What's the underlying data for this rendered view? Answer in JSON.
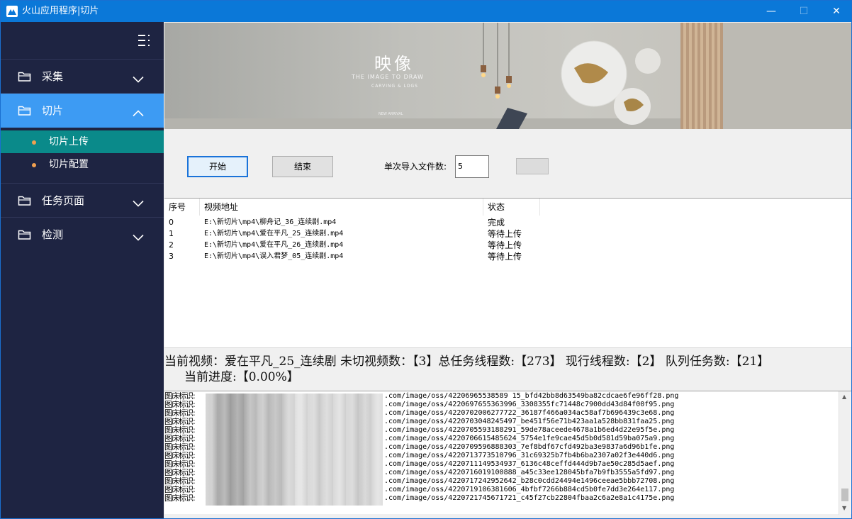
{
  "window": {
    "title": "火山应用程序|切片",
    "minimize_glyph": "—",
    "maximize_glyph": "☐",
    "close_glyph": "✕",
    "accent_color": "#0b78d8"
  },
  "sidebar": {
    "background": "#1e2442",
    "menu_icon": "menu-grid-icon",
    "items": [
      {
        "label": "采集",
        "icon": "folder-icon",
        "expanded": false
      },
      {
        "label": "切片",
        "icon": "folder-icon",
        "expanded": true,
        "active_color": "#3d9bf3"
      },
      {
        "label": "任务页面",
        "icon": "folder-icon",
        "expanded": false
      },
      {
        "label": "检测",
        "icon": "folder-icon",
        "expanded": false
      }
    ],
    "subitems": [
      {
        "label": "切片上传",
        "selected": true,
        "selected_color": "#0a8a8a"
      },
      {
        "label": "切片配置",
        "selected": false
      }
    ]
  },
  "banner": {
    "brand": "映像",
    "line1": "THE IMAGE TO DRAW",
    "line2": "CARVING & LOGS",
    "line3": "NEW ARRIVAL"
  },
  "controls": {
    "start_label": "开始",
    "end_label": "结束",
    "count_label": "单次导入文件数:",
    "count_value": "5",
    "blank_button_label": ""
  },
  "table": {
    "headers": [
      "序号",
      "视频地址",
      "状态"
    ],
    "rows": [
      [
        "0",
        "E:\\新切片\\mp4\\柳舟记_36_连续剧.mp4",
        "完成"
      ],
      [
        "1",
        "E:\\新切片\\mp4\\爱在平凡_25_连续剧.mp4",
        "等待上传"
      ],
      [
        "2",
        "E:\\新切片\\mp4\\爱在平凡_26_连续剧.mp4",
        "等待上传"
      ],
      [
        "3",
        "E:\\新切片\\mp4\\误入君梦_05_连续剧.mp4",
        "等待上传"
      ]
    ]
  },
  "status": {
    "line1": "当前视频：爱在平凡_25_连续剧  未切视频数：【3】总任务线程数:【273】 现行线程数:【2】 队列任务数:【21】",
    "line2": "当前进度:【0.00%】"
  },
  "log": {
    "prefix": "图床标识:",
    "lines": [
      ".com/image/oss/42206965538589 15_bfd42bb8d63549ba82cdcae6fe96ff28.png",
      ".com/image/oss/4220697655363996_3308355fc71448c7900dd43d84f00f95.png",
      ".com/image/oss/4220702006277722_36187f466a034ac58af7b696439c3e68.png",
      ".com/image/oss/4220703048245497_be451f56e71b423aa1a528bb831faa25.png",
      ".com/image/oss/4220705593188291_59de78aceede4678a1b6ed4d22e95f5e.png",
      ".com/image/oss/4220706615485624_5754e1fe9cae45d5b0d581d59ba075a9.png",
      ".com/image/oss/4220709596888303_7ef8bdf67cfd492ba3e9837a6d96b1fe.png",
      ".com/image/oss/4220713773510796_31c69325b7fb4b6ba2307a02f3e440d6.png",
      ".com/image/oss/4220711149534937_6136c48ceffd444d9b7ae50c285d5aef.png",
      ".com/image/oss/4220716019100888_a45c33ee128045bfa7b9fb3555a5fd97.png",
      ".com/image/oss/4220717242952642_b28c0cdd24494e1496ceeae5bbb72708.png",
      ".com/image/oss/4220719106381606_4bfbf7266b884cd5b0fe7dd3e264e117.png",
      ".com/image/oss/4220721745671721_c45f27cb22804fbaa2c6a2e8a1c4175e.png"
    ]
  }
}
